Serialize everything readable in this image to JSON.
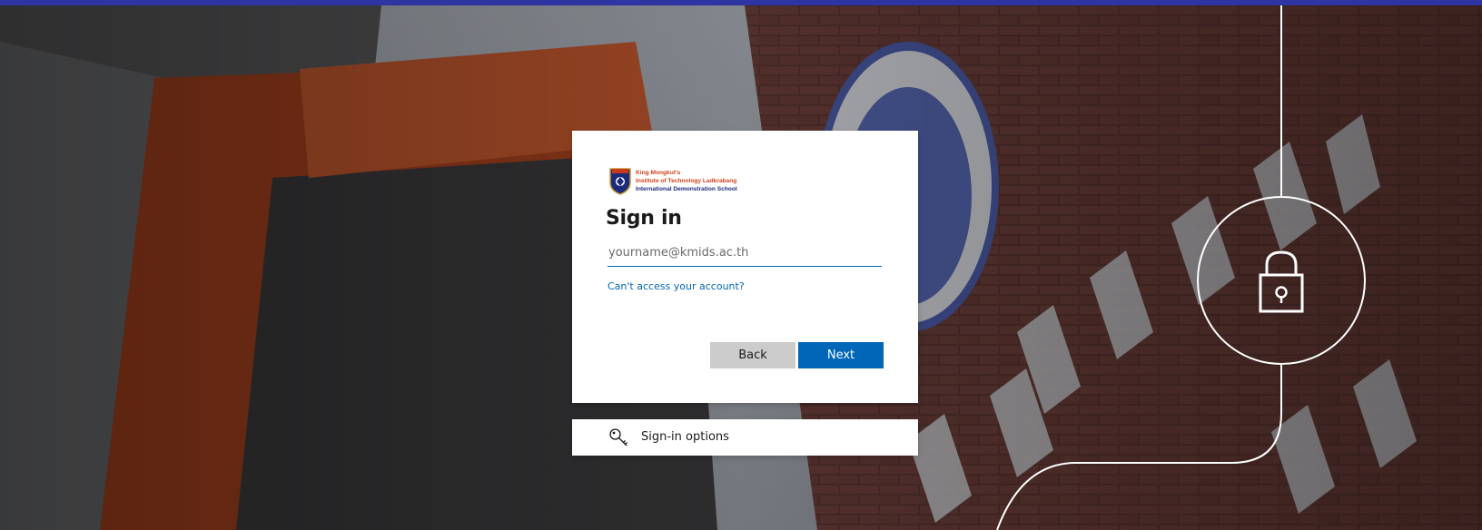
{
  "colors": {
    "top_bar": "#2e35a3",
    "accent": "#0067b8",
    "back_button": "#cccccc",
    "card": "#ffffff"
  },
  "logo": {
    "line1": "King Mongkut's",
    "line2": "Institute of Technology Ladkrabang",
    "line3": "International Demonstration School",
    "crest_icon": "school-crest-icon"
  },
  "signin": {
    "title": "Sign in",
    "email_placeholder": "yourname@kmids.ac.th",
    "email_value": "",
    "cant_access_link": "Can't access your account?",
    "back_label": "Back",
    "next_label": "Next"
  },
  "options": {
    "label": "Sign-in options",
    "icon": "key-icon"
  },
  "decoration": {
    "lock_icon": "lock-icon"
  }
}
